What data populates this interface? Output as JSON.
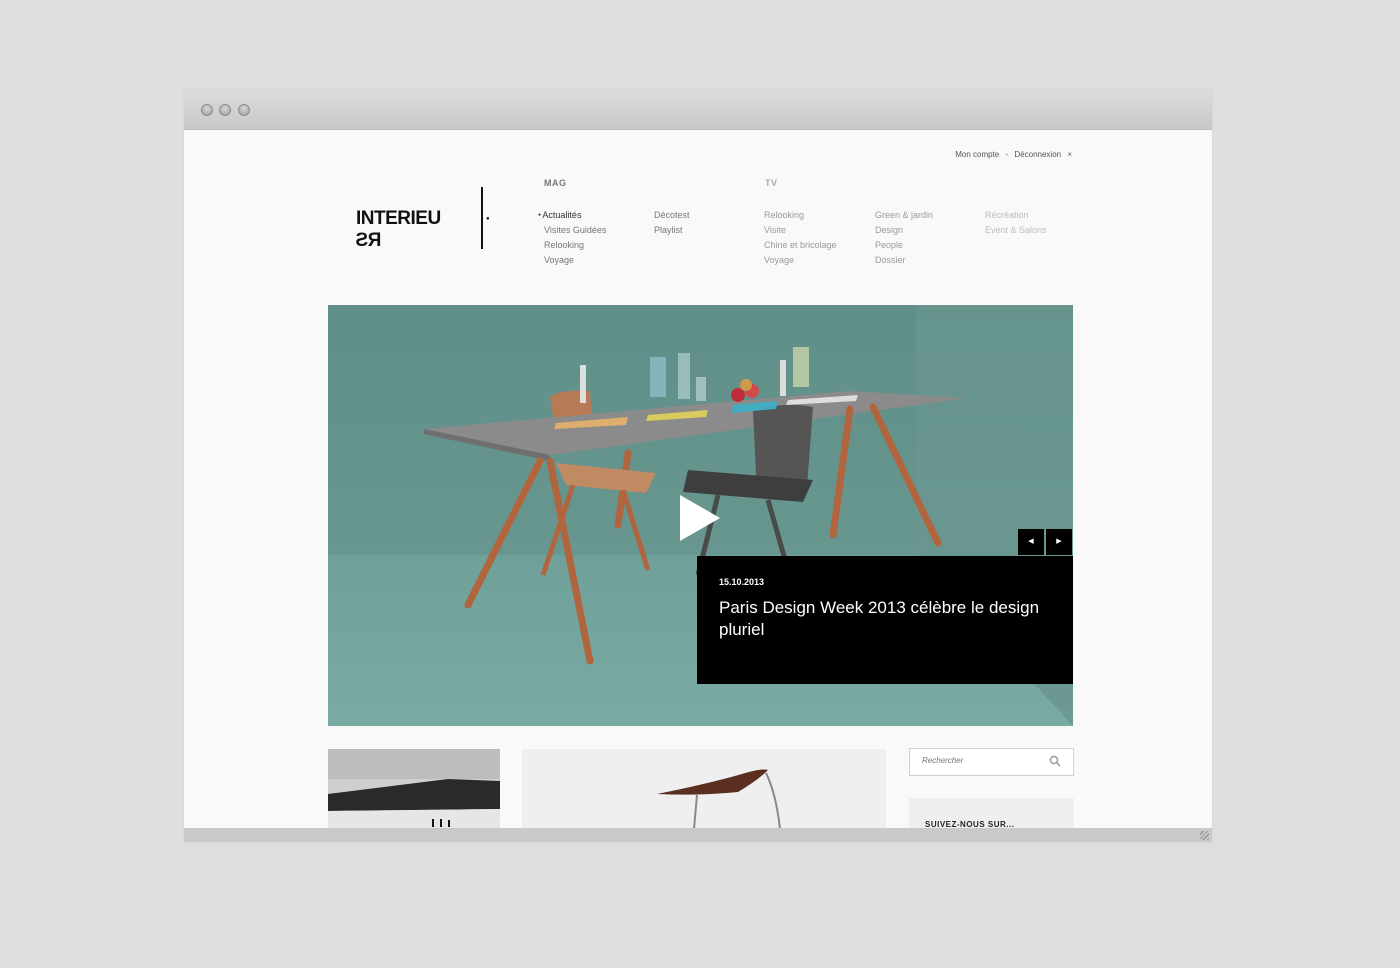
{
  "account": {
    "my_account": "Mon compte",
    "separator": "-",
    "logout": "Déconnexion",
    "close": "×"
  },
  "logo": {
    "text_main": "INTERIEU",
    "text_rev": "RS"
  },
  "nav": {
    "mag": {
      "label": "MAG",
      "col1": [
        "Actualités",
        "Visites Guidées",
        "Relooking",
        "Voyage"
      ],
      "col2": [
        "Décotest",
        "Playlist"
      ]
    },
    "tv": {
      "label": "TV",
      "col1": [
        "Relooking",
        "Visite",
        "Chine et bricolage",
        "Voyage"
      ],
      "col2": [
        "Green & jardin",
        "Design",
        "People",
        "Dossier"
      ],
      "col3": [
        "Récréation",
        "Event & Salons"
      ]
    }
  },
  "hero": {
    "date": "15.10.2013",
    "title": "Paris Design Week 2013 célèbre le design pluriel",
    "prev": "◀",
    "next": "▶"
  },
  "search": {
    "placeholder": "Rechercher"
  },
  "follow": {
    "label": "SUIVEZ-NOUS SUR..."
  }
}
